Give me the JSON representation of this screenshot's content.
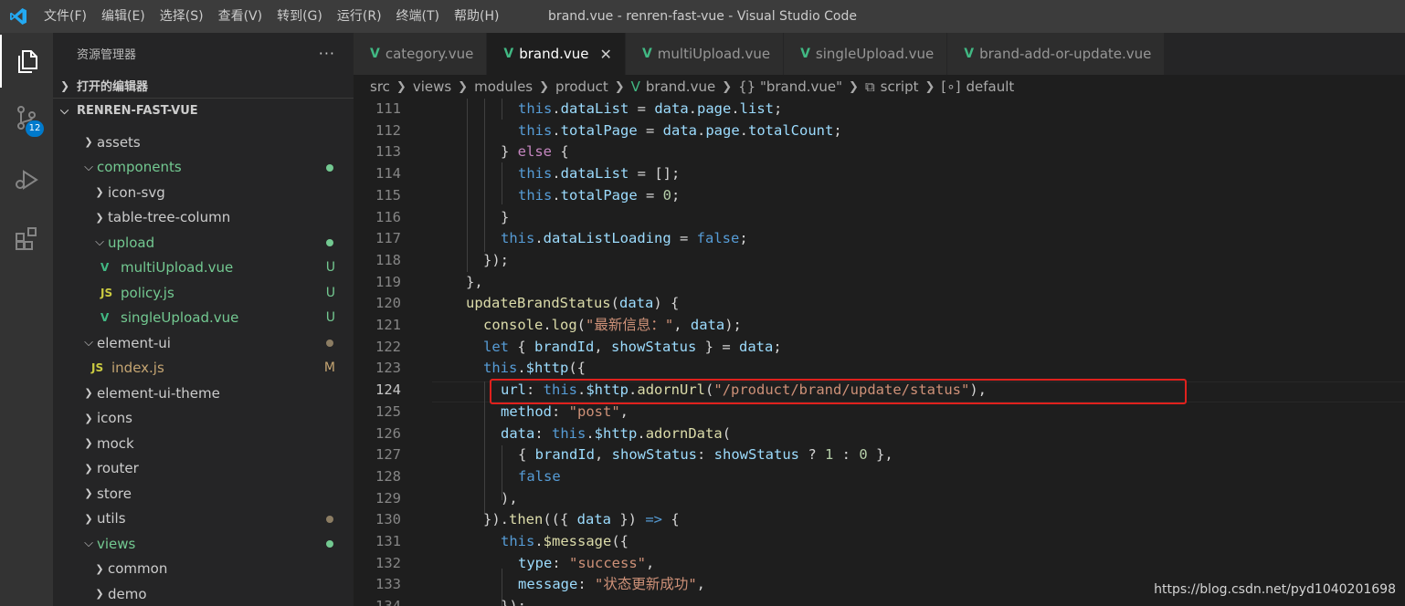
{
  "window": {
    "title": "brand.vue - renren-fast-vue - Visual Studio Code",
    "menu": [
      "文件(F)",
      "编辑(E)",
      "选择(S)",
      "查看(V)",
      "转到(G)",
      "运行(R)",
      "终端(T)",
      "帮助(H)"
    ]
  },
  "activity_bar": {
    "items": [
      {
        "icon": "files-icon",
        "active": true
      },
      {
        "icon": "source-control-icon",
        "badge": "12"
      },
      {
        "icon": "run-debug-icon"
      },
      {
        "icon": "extensions-icon"
      }
    ]
  },
  "sidebar": {
    "title": "资源管理器",
    "more": "···",
    "open_editors": "打开的编辑器",
    "project": "RENREN-FAST-VUE",
    "src_label": "src",
    "tree": [
      {
        "label": "assets",
        "type": "folder",
        "open": false,
        "depth": 1
      },
      {
        "label": "components",
        "type": "folder",
        "open": true,
        "depth": 1,
        "color": "green",
        "dot": "#73c991"
      },
      {
        "label": "icon-svg",
        "type": "folder",
        "open": false,
        "depth": 2
      },
      {
        "label": "table-tree-column",
        "type": "folder",
        "open": false,
        "depth": 2
      },
      {
        "label": "upload",
        "type": "folder",
        "open": true,
        "depth": 2,
        "color": "green",
        "dot": "#73c991"
      },
      {
        "label": "multiUpload.vue",
        "type": "vue",
        "depth": 3,
        "color": "green",
        "status": "U"
      },
      {
        "label": "policy.js",
        "type": "js",
        "depth": 3,
        "color": "green",
        "status": "U"
      },
      {
        "label": "singleUpload.vue",
        "type": "vue",
        "depth": 3,
        "color": "green",
        "status": "U"
      },
      {
        "label": "element-ui",
        "type": "folder",
        "open": true,
        "depth": 1,
        "dot": "#8c7d63"
      },
      {
        "label": "index.js",
        "type": "js",
        "depth": 2,
        "color": "olive",
        "status": "M"
      },
      {
        "label": "element-ui-theme",
        "type": "folder",
        "open": false,
        "depth": 1
      },
      {
        "label": "icons",
        "type": "folder",
        "open": false,
        "depth": 1
      },
      {
        "label": "mock",
        "type": "folder",
        "open": false,
        "depth": 1
      },
      {
        "label": "router",
        "type": "folder",
        "open": false,
        "depth": 1
      },
      {
        "label": "store",
        "type": "folder",
        "open": false,
        "depth": 1
      },
      {
        "label": "utils",
        "type": "folder",
        "open": false,
        "depth": 1,
        "dot": "#8c7d63"
      },
      {
        "label": "views",
        "type": "folder",
        "open": true,
        "depth": 1,
        "color": "green",
        "dot": "#73c991"
      },
      {
        "label": "common",
        "type": "folder",
        "open": false,
        "depth": 2
      },
      {
        "label": "demo",
        "type": "folder",
        "open": false,
        "depth": 2
      }
    ]
  },
  "tabs": [
    {
      "label": "category.vue",
      "active": false
    },
    {
      "label": "brand.vue",
      "active": true
    },
    {
      "label": "multiUpload.vue",
      "active": false
    },
    {
      "label": "singleUpload.vue",
      "active": false
    },
    {
      "label": "brand-add-or-update.vue",
      "active": false
    }
  ],
  "breadcrumb": [
    "src",
    "views",
    "modules",
    "product",
    "brand.vue",
    "{} \"brand.vue\"",
    "script",
    "default"
  ],
  "editor": {
    "lines": [
      {
        "n": "111",
        "indent": 3,
        "tokens": [
          [
            "kw",
            "this"
          ],
          [
            "pun",
            "."
          ],
          [
            "prop",
            "dataList"
          ],
          [
            "pun",
            " = "
          ],
          [
            "prop",
            "data"
          ],
          [
            "pun",
            "."
          ],
          [
            "prop",
            "page"
          ],
          [
            "pun",
            "."
          ],
          [
            "prop",
            "list"
          ],
          [
            "pun",
            ";"
          ]
        ]
      },
      {
        "n": "112",
        "indent": 3,
        "tokens": [
          [
            "kw",
            "this"
          ],
          [
            "pun",
            "."
          ],
          [
            "prop",
            "totalPage"
          ],
          [
            "pun",
            " = "
          ],
          [
            "prop",
            "data"
          ],
          [
            "pun",
            "."
          ],
          [
            "prop",
            "page"
          ],
          [
            "pun",
            "."
          ],
          [
            "prop",
            "totalCount"
          ],
          [
            "pun",
            ";"
          ]
        ]
      },
      {
        "n": "113",
        "indent": 2,
        "tokens": [
          [
            "pun",
            "} "
          ],
          [
            "ctl",
            "else"
          ],
          [
            "pun",
            " {"
          ]
        ]
      },
      {
        "n": "114",
        "indent": 3,
        "tokens": [
          [
            "kw",
            "this"
          ],
          [
            "pun",
            "."
          ],
          [
            "prop",
            "dataList"
          ],
          [
            "pun",
            " = [];"
          ]
        ]
      },
      {
        "n": "115",
        "indent": 3,
        "tokens": [
          [
            "kw",
            "this"
          ],
          [
            "pun",
            "."
          ],
          [
            "prop",
            "totalPage"
          ],
          [
            "pun",
            " = "
          ],
          [
            "num",
            "0"
          ],
          [
            "pun",
            ";"
          ]
        ]
      },
      {
        "n": "116",
        "indent": 2,
        "tokens": [
          [
            "pun",
            "}"
          ]
        ]
      },
      {
        "n": "117",
        "indent": 2,
        "tokens": [
          [
            "kw",
            "this"
          ],
          [
            "pun",
            "."
          ],
          [
            "prop",
            "dataListLoading"
          ],
          [
            "pun",
            " = "
          ],
          [
            "kw",
            "false"
          ],
          [
            "pun",
            ";"
          ]
        ]
      },
      {
        "n": "118",
        "indent": 1,
        "tokens": [
          [
            "pun",
            "});"
          ]
        ]
      },
      {
        "n": "119",
        "indent": 0,
        "tokens": [
          [
            "pun",
            "},"
          ]
        ]
      },
      {
        "n": "120",
        "indent": 0,
        "tokens": [
          [
            "fn",
            "updateBrandStatus"
          ],
          [
            "pun",
            "("
          ],
          [
            "prop",
            "data"
          ],
          [
            "pun",
            ") {"
          ]
        ]
      },
      {
        "n": "121",
        "indent": 1,
        "tokens": [
          [
            "fn",
            "console"
          ],
          [
            "pun",
            "."
          ],
          [
            "fn",
            "log"
          ],
          [
            "pun",
            "("
          ],
          [
            "str",
            "\"最新信息：\""
          ],
          [
            "pun",
            ", "
          ],
          [
            "prop",
            "data"
          ],
          [
            "pun",
            ");"
          ]
        ]
      },
      {
        "n": "122",
        "indent": 1,
        "tokens": [
          [
            "kw",
            "let"
          ],
          [
            "pun",
            " { "
          ],
          [
            "prop",
            "brandId"
          ],
          [
            "pun",
            ", "
          ],
          [
            "prop",
            "showStatus"
          ],
          [
            "pun",
            " } = "
          ],
          [
            "prop",
            "data"
          ],
          [
            "pun",
            ";"
          ]
        ]
      },
      {
        "n": "123",
        "indent": 1,
        "tokens": [
          [
            "kw",
            "this"
          ],
          [
            "pun",
            "."
          ],
          [
            "prop",
            "$http"
          ],
          [
            "pun",
            "({"
          ]
        ]
      },
      {
        "n": "124",
        "indent": 2,
        "tokens": [
          [
            "prop",
            "url"
          ],
          [
            "pun",
            ": "
          ],
          [
            "kw",
            "this"
          ],
          [
            "pun",
            "."
          ],
          [
            "prop",
            "$http"
          ],
          [
            "pun",
            "."
          ],
          [
            "fn",
            "adornUrl"
          ],
          [
            "pun",
            "("
          ],
          [
            "str",
            "\"/product/brand/update/status\""
          ],
          [
            "pun",
            "),"
          ]
        ]
      },
      {
        "n": "125",
        "indent": 2,
        "tokens": [
          [
            "prop",
            "method"
          ],
          [
            "pun",
            ": "
          ],
          [
            "str",
            "\"post\""
          ],
          [
            "pun",
            ","
          ]
        ]
      },
      {
        "n": "126",
        "indent": 2,
        "tokens": [
          [
            "prop",
            "data"
          ],
          [
            "pun",
            ": "
          ],
          [
            "kw",
            "this"
          ],
          [
            "pun",
            "."
          ],
          [
            "prop",
            "$http"
          ],
          [
            "pun",
            "."
          ],
          [
            "fn",
            "adornData"
          ],
          [
            "pun",
            "("
          ]
        ]
      },
      {
        "n": "127",
        "indent": 3,
        "tokens": [
          [
            "pun",
            "{ "
          ],
          [
            "prop",
            "brandId"
          ],
          [
            "pun",
            ", "
          ],
          [
            "prop",
            "showStatus"
          ],
          [
            "pun",
            ": "
          ],
          [
            "prop",
            "showStatus"
          ],
          [
            "pun",
            " ? "
          ],
          [
            "num",
            "1"
          ],
          [
            "pun",
            " : "
          ],
          [
            "num",
            "0"
          ],
          [
            "pun",
            " },"
          ]
        ]
      },
      {
        "n": "128",
        "indent": 3,
        "tokens": [
          [
            "kw",
            "false"
          ]
        ]
      },
      {
        "n": "129",
        "indent": 2,
        "tokens": [
          [
            "pun",
            "),"
          ]
        ]
      },
      {
        "n": "130",
        "indent": 1,
        "tokens": [
          [
            "pun",
            "})."
          ],
          [
            "fn",
            "then"
          ],
          [
            "pun",
            "(({ "
          ],
          [
            "prop",
            "data"
          ],
          [
            "pun",
            " }) "
          ],
          [
            "kw",
            "=>"
          ],
          [
            "pun",
            " {"
          ]
        ]
      },
      {
        "n": "131",
        "indent": 2,
        "tokens": [
          [
            "kw",
            "this"
          ],
          [
            "pun",
            "."
          ],
          [
            "fn",
            "$message"
          ],
          [
            "pun",
            "({"
          ]
        ]
      },
      {
        "n": "132",
        "indent": 3,
        "tokens": [
          [
            "prop",
            "type"
          ],
          [
            "pun",
            ": "
          ],
          [
            "str",
            "\"success\""
          ],
          [
            "pun",
            ","
          ]
        ]
      },
      {
        "n": "133",
        "indent": 3,
        "tokens": [
          [
            "prop",
            "message"
          ],
          [
            "pun",
            ": "
          ],
          [
            "str",
            "\"状态更新成功\""
          ],
          [
            "pun",
            ","
          ]
        ]
      },
      {
        "n": "134",
        "indent": 2,
        "tokens": [
          [
            "pun",
            "});"
          ]
        ]
      }
    ]
  },
  "watermark": "https://blog.csdn.net/pyd1040201698"
}
